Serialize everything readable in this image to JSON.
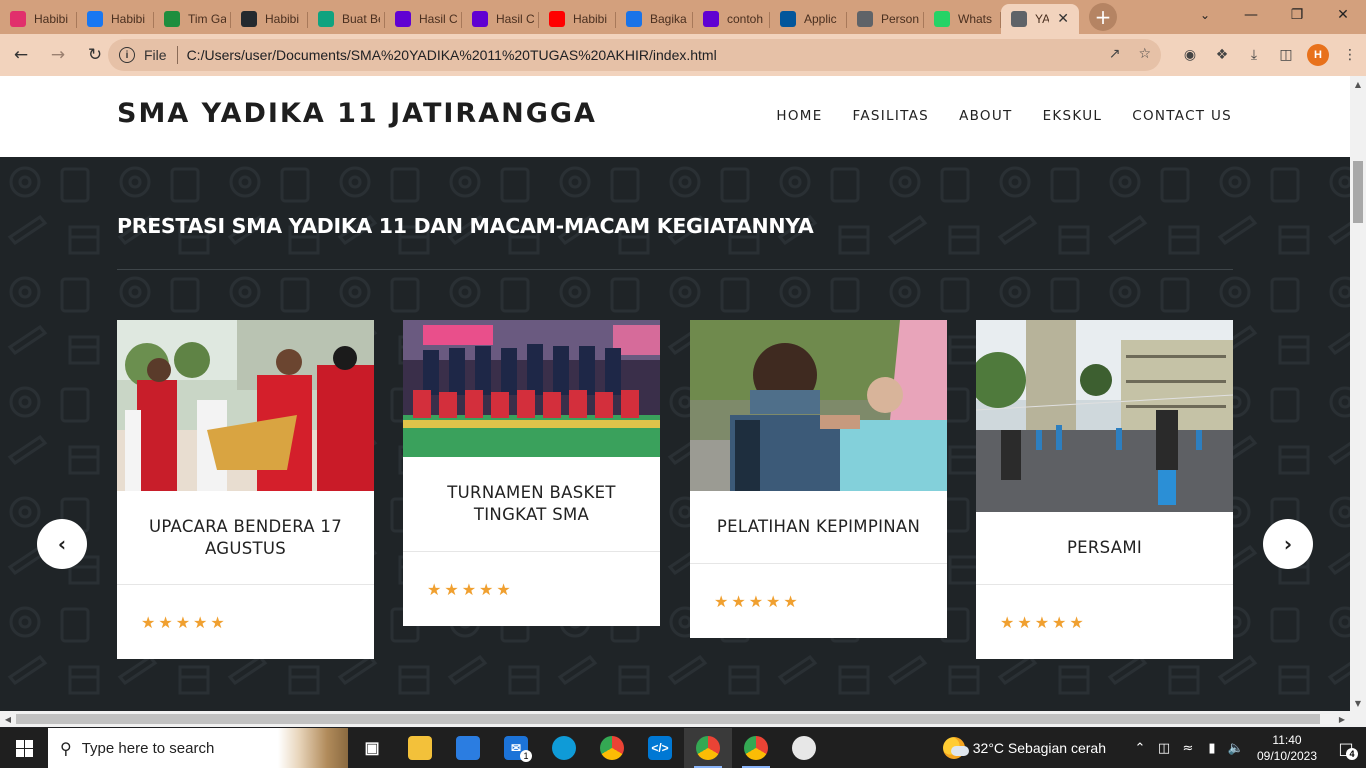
{
  "browser": {
    "tabs": [
      {
        "title": "Habibi",
        "favicon": "instagram-icon",
        "color": "#e1306c"
      },
      {
        "title": "Habibi",
        "favicon": "facebook-icon",
        "color": "#1877f2"
      },
      {
        "title": "Tim Ga",
        "favicon": "plus-icon",
        "color": "#1e8e3e"
      },
      {
        "title": "Habibi",
        "favicon": "github-icon",
        "color": "#24292e"
      },
      {
        "title": "Buat Be",
        "favicon": "chatgpt-icon",
        "color": "#10a37f"
      },
      {
        "title": "Hasil C",
        "favicon": "yahoo-icon",
        "color": "#6001d2"
      },
      {
        "title": "Hasil C",
        "favicon": "yahoo-icon",
        "color": "#6001d2"
      },
      {
        "title": "Habibi",
        "favicon": "youtube-icon",
        "color": "#ff0000"
      },
      {
        "title": "Bagika",
        "favicon": "dot-icon",
        "color": "#1a73e8"
      },
      {
        "title": "contoh",
        "favicon": "yahoo-icon",
        "color": "#6001d2"
      },
      {
        "title": "Applic",
        "favicon": "flutter-icon",
        "color": "#02569b"
      },
      {
        "title": "Person",
        "favicon": "avatar-icon",
        "color": "#5f6368"
      },
      {
        "title": "Whats",
        "favicon": "whatsapp-icon",
        "color": "#25d366"
      },
      {
        "title": "YA",
        "favicon": "globe-icon",
        "color": "#5f6368",
        "active": true
      }
    ],
    "address": {
      "scheme_label": "File",
      "url": "C:/Users/user/Documents/SMA%20YADIKA%2011%20TUGAS%20AKHIR/index.html"
    },
    "profile_initial": "H"
  },
  "site": {
    "logo": "SMA YADIKA 11 JATIRANGGA",
    "nav": [
      "HOME",
      "FASILITAS",
      "ABOUT",
      "EKSKUL",
      "CONTACT US"
    ],
    "section_title": "PRESTASI SMA YADIKA 11 DAN MACAM-MACAM KEGIATANNYA",
    "cards": [
      {
        "title": "UPACARA BENDERA 17 AGUSTUS",
        "rating": 5
      },
      {
        "title": "TURNAMEN BASKET TINGKAT SMA",
        "rating": 5
      },
      {
        "title": "PELATIHAN KEPIMPINAN",
        "rating": 5
      },
      {
        "title": "PERSAMI",
        "rating": 5
      }
    ],
    "prev_label": "‹",
    "next_label": "›"
  },
  "taskbar": {
    "search_placeholder": "Type here to search",
    "weather": "32°C  Sebagian cerah",
    "time": "11:40",
    "date": "09/10/2023",
    "notification_count": "4",
    "mail_badge": "1"
  }
}
